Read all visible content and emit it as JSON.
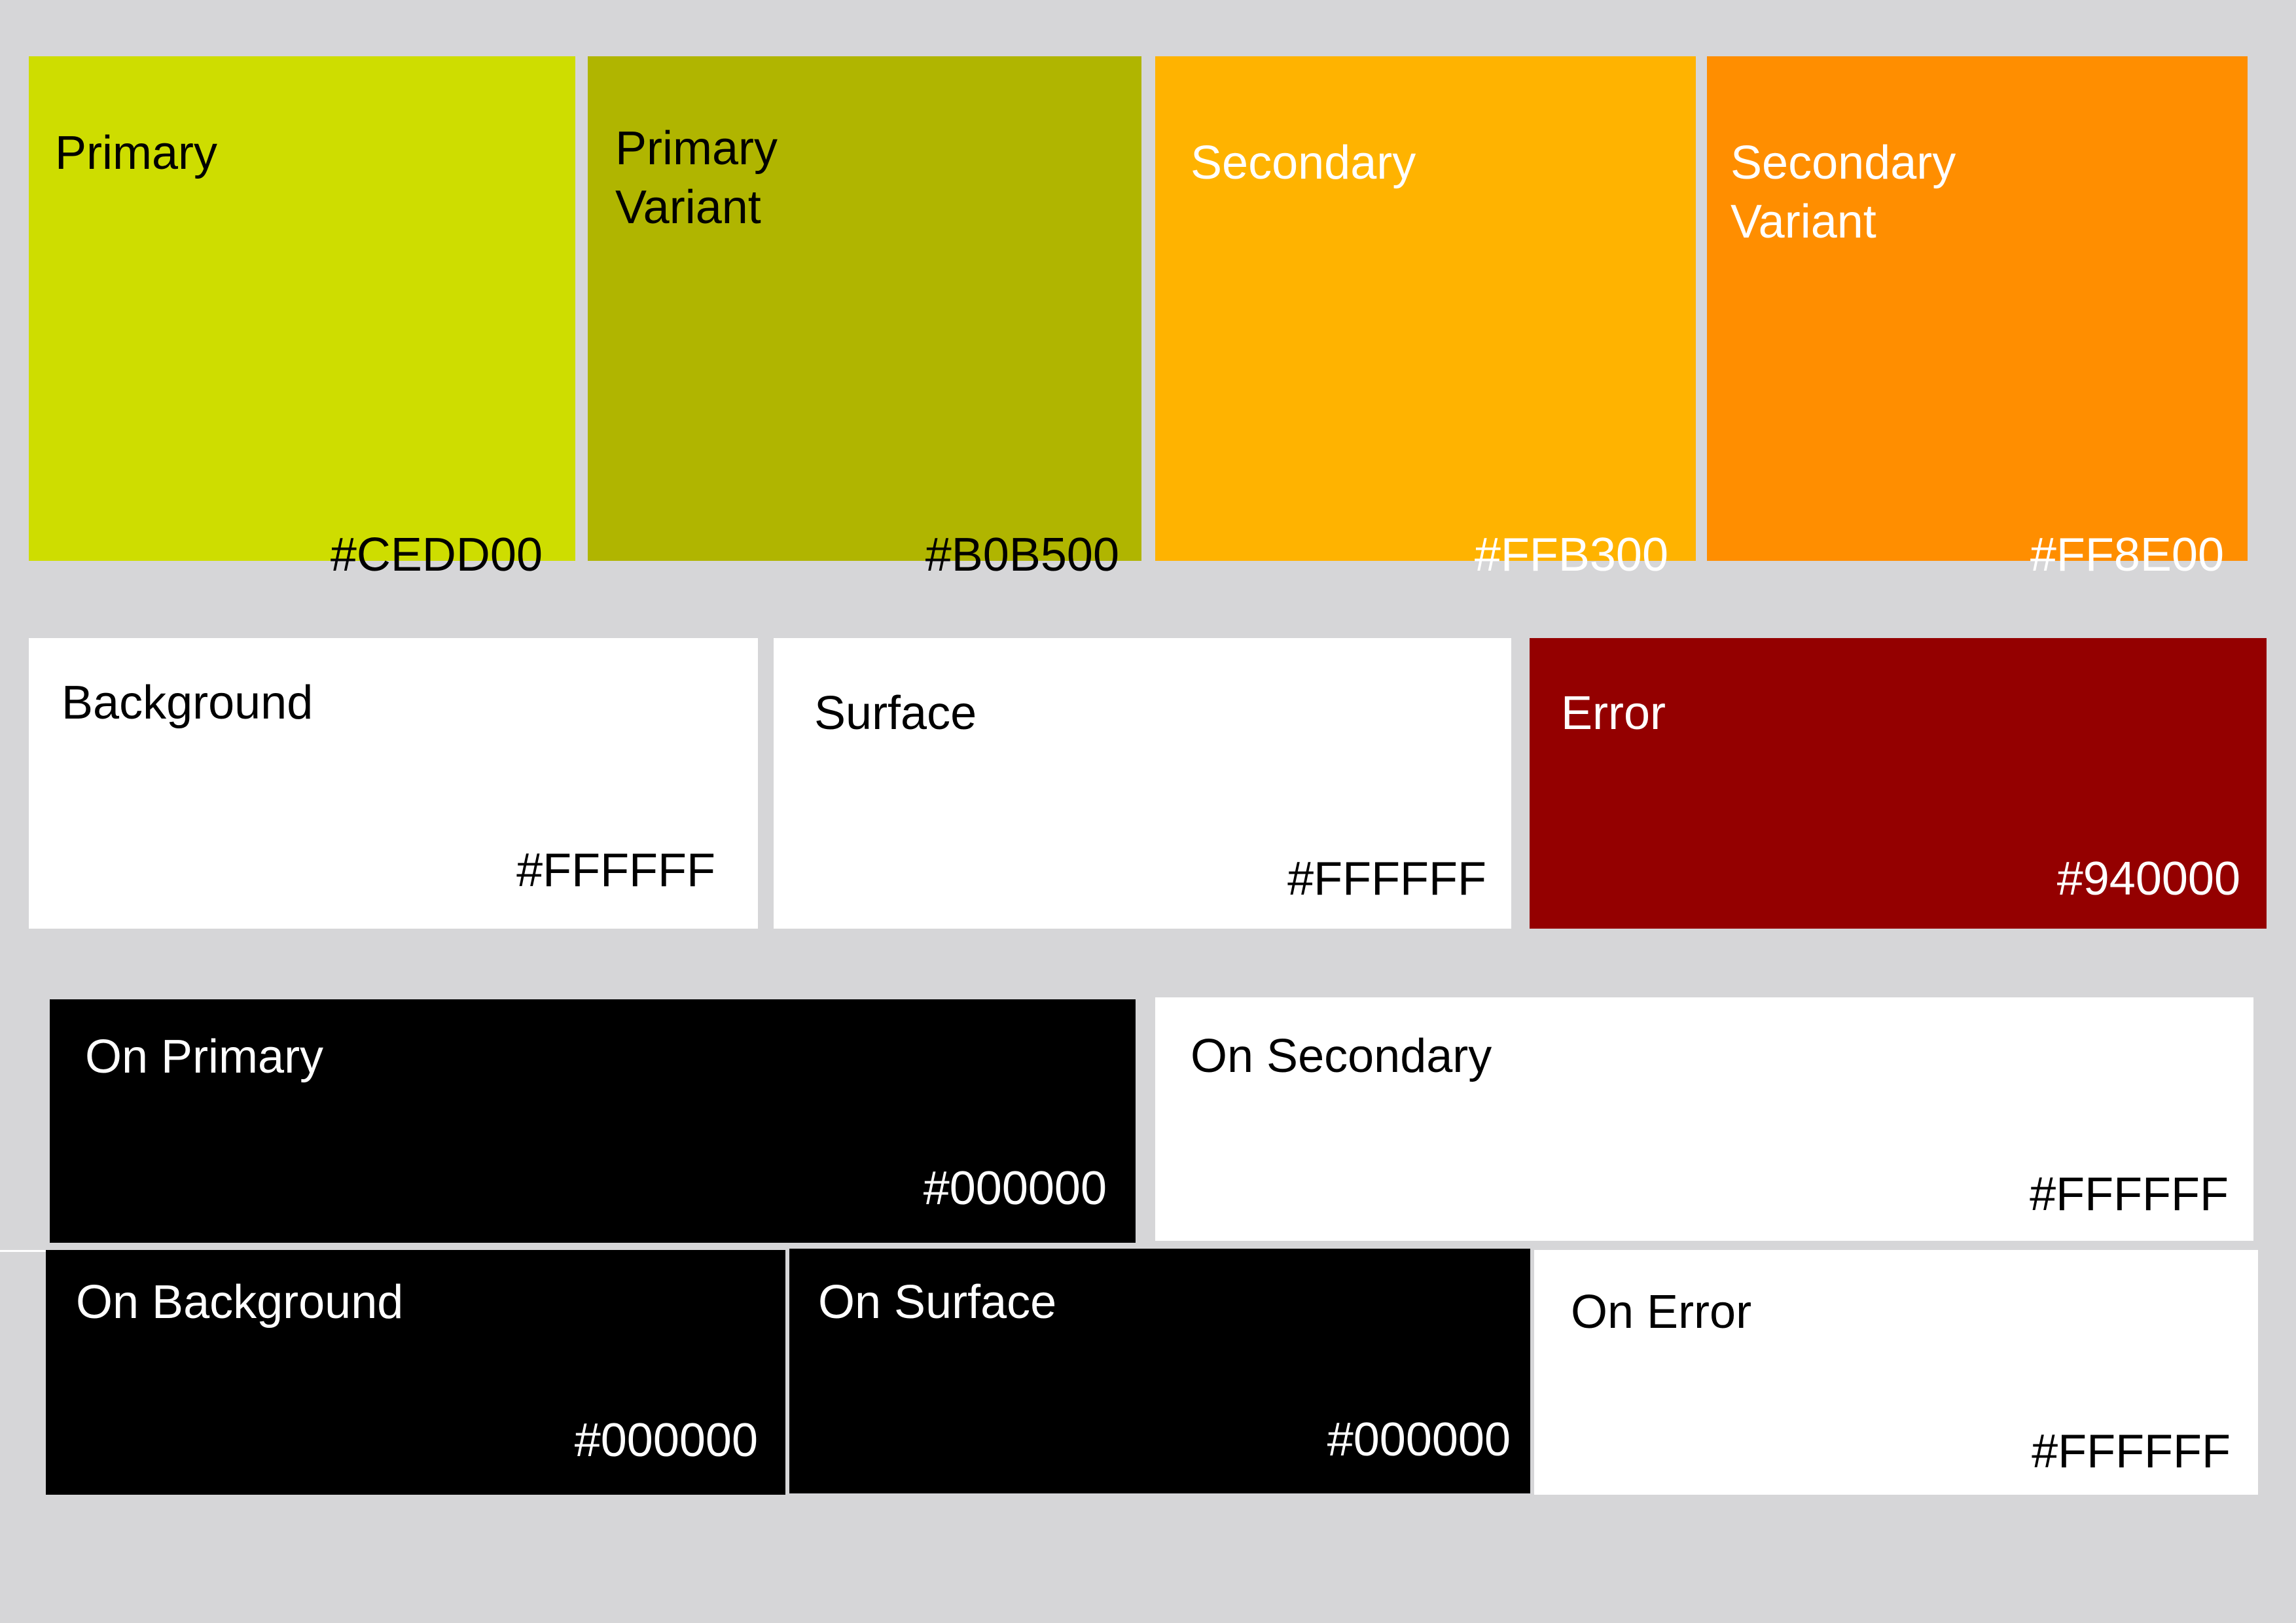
{
  "palette": {
    "primary": {
      "name": "Primary",
      "hex": "#CEDD00",
      "color": "#CEDD00",
      "text_color": "#000000"
    },
    "primary_variant": {
      "name": "Primary\nVariant",
      "hex": "#B0B500",
      "color": "#B0B500",
      "text_color": "#000000"
    },
    "secondary": {
      "name": "Secondary",
      "hex": "#FFB300",
      "color": "#FFB300",
      "text_color": "#FFFFFF"
    },
    "secondary_variant": {
      "name": "Secondary\nVariant",
      "hex": "#FF8E00",
      "color": "#FF8E00",
      "text_color": "#FFFFFF"
    },
    "background": {
      "name": "Background",
      "hex": "#FFFFFF",
      "color": "#FFFFFF",
      "text_color": "#000000"
    },
    "surface": {
      "name": "Surface",
      "hex": "#FFFFFF",
      "color": "#FFFFFF",
      "text_color": "#000000"
    },
    "error": {
      "name": "Error",
      "hex": "#940000",
      "color": "#940000",
      "text_color": "#FFFFFF"
    },
    "on_primary": {
      "name": "On Primary",
      "hex": "#000000",
      "color": "#000000",
      "text_color": "#FFFFFF"
    },
    "on_secondary": {
      "name": "On Secondary",
      "hex": "#FFFFFF",
      "color": "#FFFFFF",
      "text_color": "#000000"
    },
    "on_background": {
      "name": "On Background",
      "hex": "#000000",
      "color": "#000000",
      "text_color": "#FFFFFF"
    },
    "on_surface": {
      "name": "On Surface",
      "hex": "#000000",
      "color": "#000000",
      "text_color": "#FFFFFF"
    },
    "on_error": {
      "name": "On Error",
      "hex": "#FFFFFF",
      "color": "#FFFFFF",
      "text_color": "#000000"
    }
  },
  "page_background": "#D6D6D8"
}
